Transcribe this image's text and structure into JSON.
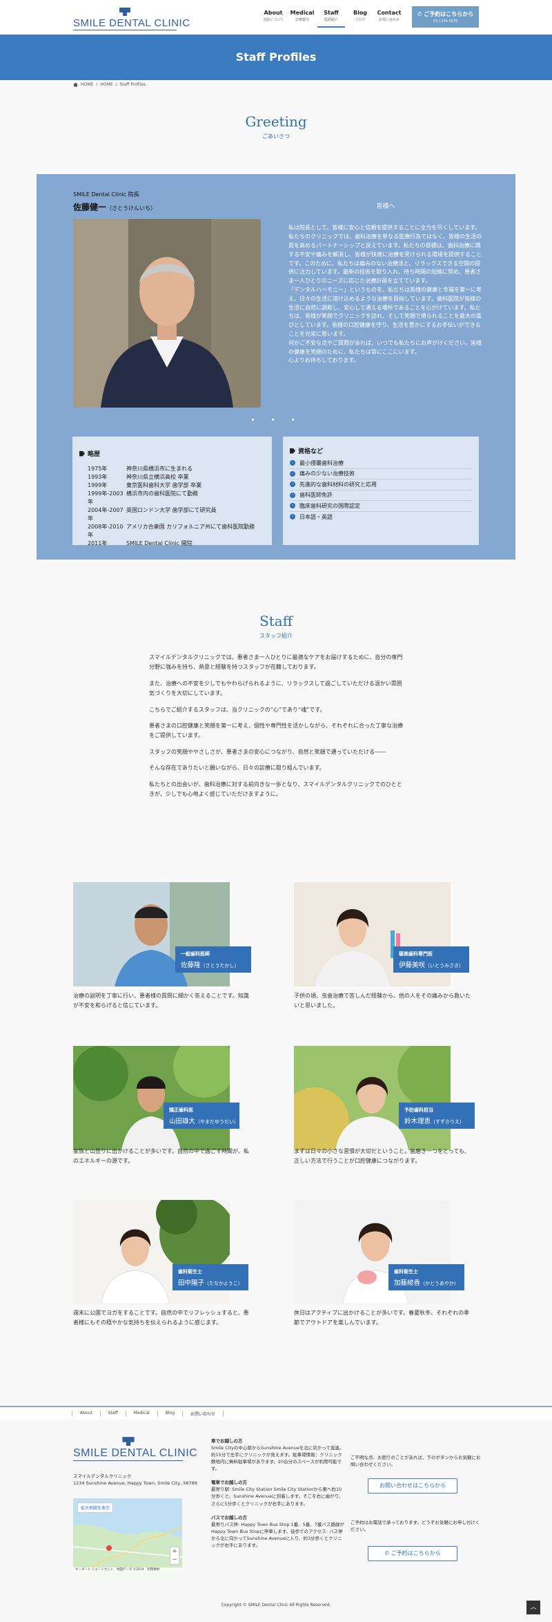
{
  "header": {
    "logo": "SMILE DENTAL CLINIC",
    "nav": [
      {
        "en": "About",
        "jp": "当院について"
      },
      {
        "en": "Medical",
        "jp": "診療案内"
      },
      {
        "en": "Staff",
        "jp": "医師紹介"
      },
      {
        "en": "Blog",
        "jp": "ブログ"
      },
      {
        "en": "Contact",
        "jp": "お問い合わせ"
      }
    ],
    "reserve": "ご予約はこちらから",
    "reserve_tel": "03-1234-5678"
  },
  "hero": {
    "title": "Staff Profiles"
  },
  "breadcrumb": {
    "home": "HOME",
    "sep": "/",
    "home2": "HOME",
    "current": "Staff Profiles"
  },
  "greeting": {
    "title_en": "Greeting",
    "title_jp": "ごあいさつ",
    "subtitle": "SMILE Dental Clinic 院長",
    "name": "佐藤健一",
    "name_kana": "（さとうけんいち）",
    "message_head": "皆様へ",
    "message": [
      "私は院長として、皆様に安心と信頼を提供することに全力を尽くしています。",
      "私たちのクリニックでは、歯科治療を単なる医療行為ではなく、皆様の生活の質を高めるパートナーシップと捉えています。私たちの目標は、歯科治療に関する不安や痛みを解消し、皆様が快適に治療を受けられる環境を提供することです。このために、私たちは痛みのない治療法と、リラックスできる空間の提供に注力しています。最新の技術を取り入れ、待ち時間の短縮に努め、患者さま一人ひとりのニーズに応じた治療計画を立てています。",
      "「デンタルハーモニー」というものを、私たちは皆様の健康と幸福を第一に考え、日々の生活に溶け込めるような治療を目指しています。歯科医院が皆様の生活に自然に調和し、安心して通える場所であることを心がけています。私たちは、皆様が笑顔でクリニックを訪れ、そして笑顔で帰られることを最大の喜びとしています。皆様の口腔健康を守り、生活を豊かにするお手伝いができることを光栄に思います。",
      "何かご不安な点やご質問があれば、いつでも私たちにお声がけください。皆様の健康を笑顔のために、私たちは常にここにいます。",
      "心よりお待ちしております。"
    ],
    "history_title": "略歴",
    "history": [
      {
        "year": "1975年",
        "text": "神奈川県横浜市に生まれる"
      },
      {
        "year": "1993年",
        "text": "神奈川県立横浜高校 卒業"
      },
      {
        "year": "1999年",
        "text": "東京医科歯科大学 歯学部 卒業"
      },
      {
        "year": "1999年-2003年",
        "text": "横浜市内の歯科医院にて勤務"
      },
      {
        "year": "2004年-2007年",
        "text": "英国ロンドン大学 歯学部にて研究員"
      },
      {
        "year": "2008年-2010年",
        "text": "アメリカ合衆国 カリフォルニア州にて歯科医院勤務"
      },
      {
        "year": "2011年",
        "text": "SMILE Dental Clinic 開院"
      }
    ],
    "qual_title": "資格など",
    "qualifications": [
      "最小侵襲歯科治療",
      "痛みの少ない治療技術",
      "先進的な歯科材料の研究と応用",
      "歯科医師免許",
      "臨床歯科研究の国際認定",
      "日本語・英語"
    ]
  },
  "staff": {
    "title_en": "Staff",
    "title_jp": "スタッフ紹介",
    "intro": [
      "スマイルデンタルクリニックでは、患者さま一人ひとりに最適なケアをお届けするために、自分の専門分野に強みを持ち、熱意と経験を持つスタッフが在籍しております。",
      "また、治療への不安を少しでもやわらげられるように、リラックスして過ごしていただける温かい雰囲気づくりを大切にしています。",
      "こちらでご紹介するスタッフは、当クリニックの“心”であり“魂”です。",
      "患者さまの口腔健康と笑顔を第一に考え、個性や専門性を活かしながら、それぞれに合った丁寧な治療をご提供しています。",
      "スタッフの笑顔ややさしさが、患者さまの安心につながり、自然と笑顔で通っていただける――",
      "そんな存在でありたいと願いながら、日々の診療に取り組んでいます。",
      "私たちとの出会いが、歯科治療に対する前向きな一歩となり、スマイルデンタルクリニックでのひとときが、少しでも心地よく感じていただけますように。"
    ],
    "members": [
      {
        "role": "一般歯科医師",
        "name": "佐藤隆",
        "kana": "（さとうたかし）",
        "desc": "治療の説明を丁寧に行い、患者様の質問に細かく答えることです。知識が不安を和らげると信じています。"
      },
      {
        "role": "審美歯科専門医",
        "name": "伊藤美咲",
        "kana": "（いとうみさき）",
        "desc": "子供の頃、虫歯治療で苦しんだ経験から、他の人をその痛みから救いたいと思いました。"
      },
      {
        "role": "矯正歯科医",
        "name": "山田雄大",
        "kana": "（やまだゆうだい）",
        "desc": "家族と山登りに出かけることが多いです。自然の中で過ごす時間が、私のエネルギーの源です。"
      },
      {
        "role": "予防歯科担当",
        "name": "鈴木理恵",
        "kana": "（すずきりえ）",
        "desc": "まずは日々の小さな習慣が大切だということ。歯磨き一つをとっても、正しい方法で行うことが口腔健康につながります。"
      },
      {
        "role": "歯科衛生士",
        "name": "田中陽子",
        "kana": "（たなかようこ）",
        "desc": "週末に公園でヨガをすることです。自然の中でリフレッシュすると、患者様にもその穏やかな気持ちを伝えられるように感じます。"
      },
      {
        "role": "歯科衛生士",
        "name": "加藤綾香",
        "kana": "（かとうあやか）",
        "desc": "休日はアクティブに出かけることが多いです。春夏秋冬、それぞれの季節でアウトドアを楽しんでいます。"
      }
    ]
  },
  "footer": {
    "nav": [
      "About",
      "Staff",
      "Medical",
      "Blog",
      "お問い合わせ"
    ],
    "logo": "SMILE DENTAL CLINIC",
    "clinic_name": "スマイルデンタルクリニック",
    "address": "1234 Sunshine Avenue, Happy Town, Smile City, 56789",
    "map_button": "拡大地図を表示",
    "map_attr": "キーボード ショートカット　地図データ ©2024　利用規約",
    "access": [
      {
        "head": "車でお越しの方",
        "text": "Smile Cityの中心部からSunshine Avenueを北に向かって直進。約15分で左手にクリニックが見えます。駐車場情報：クリニック敷地内に無料駐車場があります。20台分のスペースが利用可能です。"
      },
      {
        "head": "電車でお越しの方",
        "text": "最寄り駅: Smile City Station Smile City Stationから東へ約10分歩くと、Sunshine Avenueに到着します。そこを右に曲がり、さらに5分歩くとクリニックが右手にあります。"
      },
      {
        "head": "バスでお越しの方",
        "text": "最寄りバス停: Happy Town Bus Stop 1番、5番、7番バス路線がHappy Town Bus Stopに停車します。徒歩でのアクセス: バス停から北に向かってSunshine Avenueに入り、約3分歩くとクリニックが右手にあります。"
      }
    ],
    "contact_note": "ご不明な点、お困りのことがあれば、下のボタンからお気軽にお問い合わせください。",
    "contact_btn": "お問い合わせはこちらから",
    "phone_note": "ご予約はお電話で承っております。どうぞお気軽にお申し付けください。",
    "phone_btn": "ご予約はこちらから",
    "copyright": "Copyright © SMILE Dental Clinic All Rights Reserved."
  },
  "colors": {
    "primary": "#3a7bbf",
    "panel": "#84a8d2",
    "label": "#3470b5"
  }
}
